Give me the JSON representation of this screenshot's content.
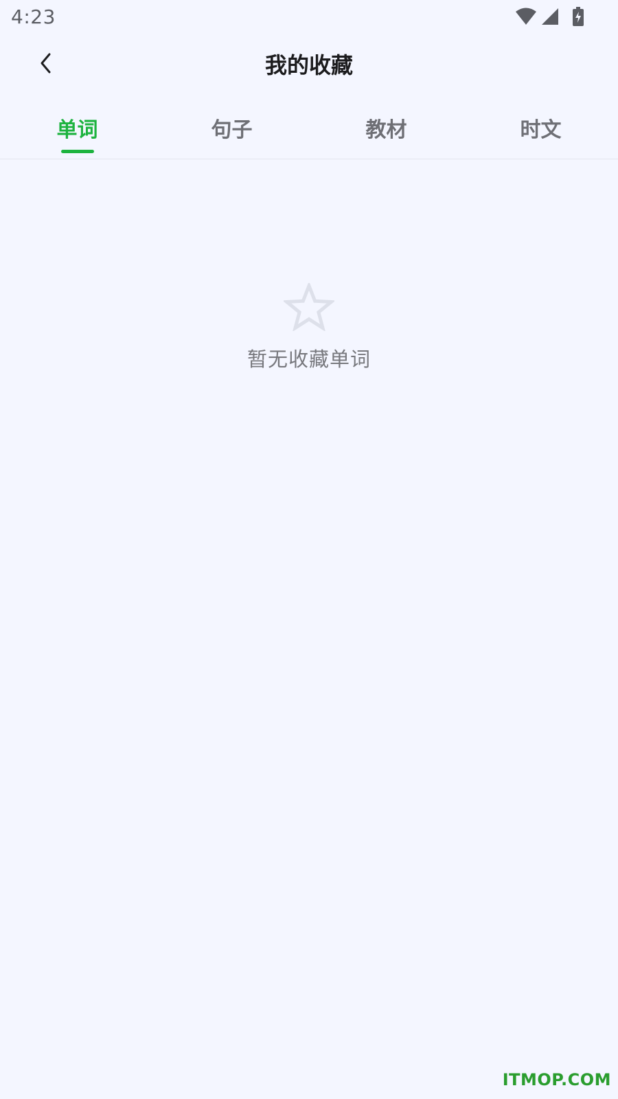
{
  "status_bar": {
    "time": "4:23",
    "icons": [
      "wifi-icon",
      "cell-signal-icon",
      "battery-charging-icon"
    ],
    "icon_color": "#5b5d63"
  },
  "header": {
    "back_icon": "chevron-left-icon",
    "title": "我的收藏"
  },
  "tabs": [
    {
      "label": "单词",
      "active": true
    },
    {
      "label": "句子",
      "active": false
    },
    {
      "label": "教材",
      "active": false
    },
    {
      "label": "时文",
      "active": false
    }
  ],
  "empty_state": {
    "icon": "star-outline-icon",
    "message": "暂无收藏单词"
  },
  "watermark": "ITMOP.COM",
  "colors": {
    "accent": "#1db33f",
    "background": "#f4f6ff",
    "tab_inactive": "#6e6f75",
    "title": "#1c1c1e",
    "empty_icon": "#dde0ea",
    "watermark": "#2a9d2e"
  }
}
